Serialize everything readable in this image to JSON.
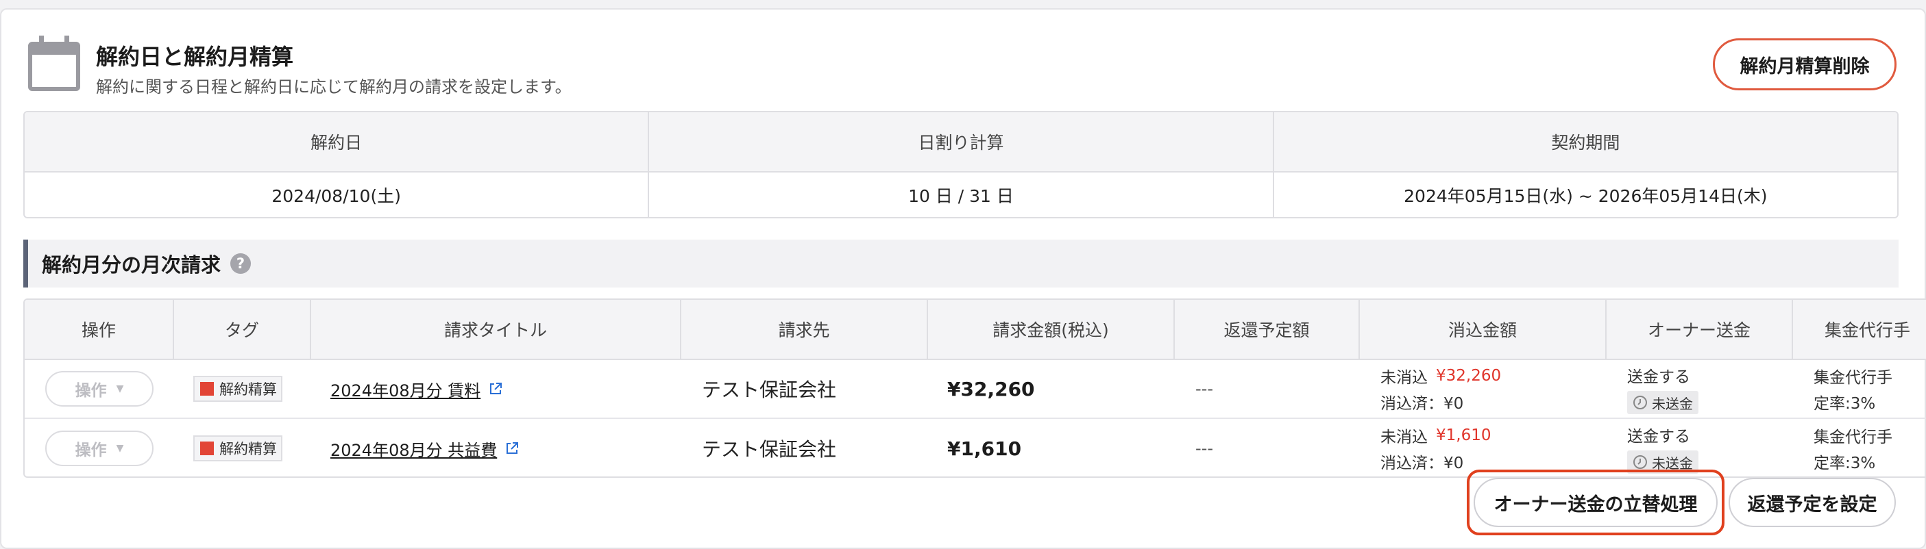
{
  "header": {
    "title": "解約日と解約月精算",
    "subtitle": "解約に関する日程と解約日に応じて解約月の請求を設定します。",
    "delete_button": "解約月精算削除"
  },
  "summary": {
    "headers": [
      "解約日",
      "日割り計算",
      "契約期間"
    ],
    "values": [
      "2024/08/10(土)",
      "10 日 / 31 日",
      "2024年05月15日(水) ~ 2026年05月14日(木)"
    ]
  },
  "section": {
    "title": "解約月分の月次請求",
    "help": "?"
  },
  "billing": {
    "columns": [
      "操作",
      "タグ",
      "請求タイトル",
      "請求先",
      "請求金額(税込)",
      "返還予定額",
      "消込金額",
      "オーナー送金",
      "集金代行手"
    ],
    "rows": [
      {
        "ops": "操作",
        "tag": "解約精算",
        "title": "2024年08月分 賃料",
        "payer": "テスト保証会社",
        "amount": "¥32,260",
        "refund": "---",
        "unreconciled_label": "未消込",
        "unreconciled_value": "¥32,260",
        "reconciled": "消込済：¥0",
        "owner_status": "送金する",
        "owner_badge": "未送金",
        "agency_line1": "集金代行手",
        "agency_line2": "定率:3%"
      },
      {
        "ops": "操作",
        "tag": "解約精算",
        "title": "2024年08月分 共益費",
        "payer": "テスト保証会社",
        "amount": "¥1,610",
        "refund": "---",
        "unreconciled_label": "未消込",
        "unreconciled_value": "¥1,610",
        "reconciled": "消込済：¥0",
        "owner_status": "送金する",
        "owner_badge": "未送金",
        "agency_line1": "集金代行手",
        "agency_line2": "定率:3%"
      }
    ]
  },
  "actions": {
    "owner_advance": "オーナー送金の立替処理",
    "set_refund": "返還予定を設定"
  },
  "colors": {
    "accent_red": "#e0352b",
    "tag_red": "#e24536",
    "section_bar": "#5c6478"
  }
}
